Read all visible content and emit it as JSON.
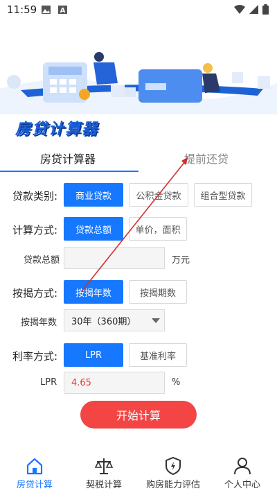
{
  "status_bar": {
    "time": "11:59",
    "icons": [
      "image-icon",
      "a-app-icon",
      "wifi-icon",
      "signal-icon",
      "battery-icon"
    ]
  },
  "header": {
    "brand_title": "房贷计算器"
  },
  "tabs": [
    {
      "label": "房贷计算器",
      "active": true
    },
    {
      "label": "提前还贷",
      "active": false
    }
  ],
  "form": {
    "loan_type": {
      "label": "贷款类别:",
      "options": [
        "商业贷款",
        "公积金贷款",
        "组合型贷款"
      ],
      "selected": "商业贷款"
    },
    "calc_method": {
      "label": "计算方式:",
      "options": [
        "贷款总额",
        "单价，面积"
      ],
      "selected": "贷款总额"
    },
    "loan_total": {
      "label": "贷款总额",
      "value": "",
      "unit": "万元"
    },
    "mortgage_method": {
      "label": "按揭方式:",
      "options": [
        "按揭年数",
        "按揭期数"
      ],
      "selected": "按揭年数"
    },
    "mortgage_years": {
      "label": "按揭年数",
      "value": "30年（360期）"
    },
    "rate_method": {
      "label": "利率方式:",
      "options": [
        "LPR",
        "基准利率"
      ],
      "selected": "LPR"
    },
    "lpr": {
      "label": "LPR",
      "value": "4.65",
      "unit": "%"
    },
    "submit_label": "开始计算"
  },
  "bottom_nav": [
    {
      "label": "房贷计算",
      "icon": "house-icon",
      "active": true
    },
    {
      "label": "契税计算",
      "icon": "scale-icon",
      "active": false
    },
    {
      "label": "购房能力评估",
      "icon": "shield-bolt-icon",
      "active": false
    },
    {
      "label": "个人中心",
      "icon": "person-icon",
      "active": false
    }
  ],
  "colors": {
    "accent": "#1677ff",
    "brand": "#1a5fd8",
    "submit": "#f44545",
    "value_text": "#e53935",
    "annotation_arrow": "#d32f2f"
  }
}
